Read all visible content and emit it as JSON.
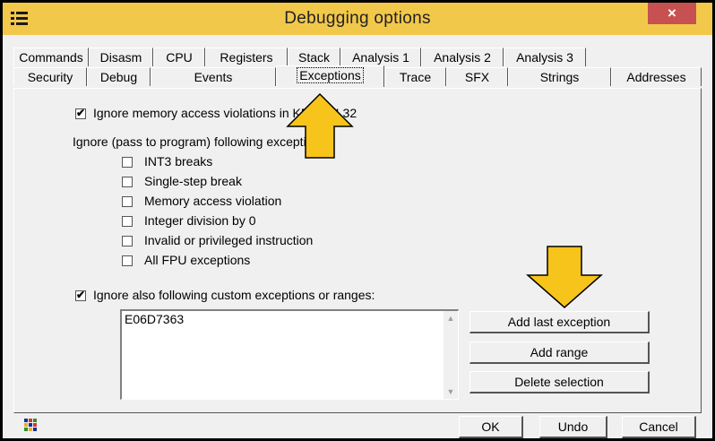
{
  "window": {
    "title": "Debugging options",
    "close_glyph": "×"
  },
  "tabs_row1": [
    {
      "label": "Commands"
    },
    {
      "label": "Disasm"
    },
    {
      "label": "CPU"
    },
    {
      "label": "Registers"
    },
    {
      "label": "Stack"
    },
    {
      "label": "Analysis 1"
    },
    {
      "label": "Analysis 2"
    },
    {
      "label": "Analysis 3"
    }
  ],
  "tabs_row2": [
    {
      "label": "Security"
    },
    {
      "label": "Debug"
    },
    {
      "label": "Events"
    },
    {
      "label": "Exceptions",
      "active": true
    },
    {
      "label": "Trace"
    },
    {
      "label": "SFX"
    },
    {
      "label": "Strings"
    },
    {
      "label": "Addresses"
    }
  ],
  "exceptions": {
    "ignore_kernel32": {
      "label": "Ignore memory access violations in KERNEL32",
      "checked": true
    },
    "section_label": "Ignore (pass to program) following exceptions:",
    "options": [
      {
        "label": "INT3 breaks",
        "checked": false
      },
      {
        "label": "Single-step break",
        "checked": false
      },
      {
        "label": "Memory access violation",
        "checked": false
      },
      {
        "label": "Integer division by 0",
        "checked": false
      },
      {
        "label": "Invalid or privileged instruction",
        "checked": false
      },
      {
        "label": "All FPU exceptions",
        "checked": false
      }
    ],
    "custom": {
      "label": "Ignore also following custom exceptions or ranges:",
      "checked": true
    },
    "custom_list": [
      "E06D7363"
    ],
    "buttons": {
      "add_last": "Add last exception",
      "add_range": "Add range",
      "delete": "Delete selection"
    }
  },
  "footer": {
    "ok": "OK",
    "undo": "Undo",
    "cancel": "Cancel"
  },
  "colors": {
    "titlebar": "#f2c84b",
    "close": "#c75050",
    "arrow_fill": "#f7c41b",
    "arrow_stroke": "#000000"
  },
  "icons": {
    "system_menu": "menu-lines-icon",
    "app": "ollydbg-grid-icon",
    "checkmark": "✔"
  }
}
